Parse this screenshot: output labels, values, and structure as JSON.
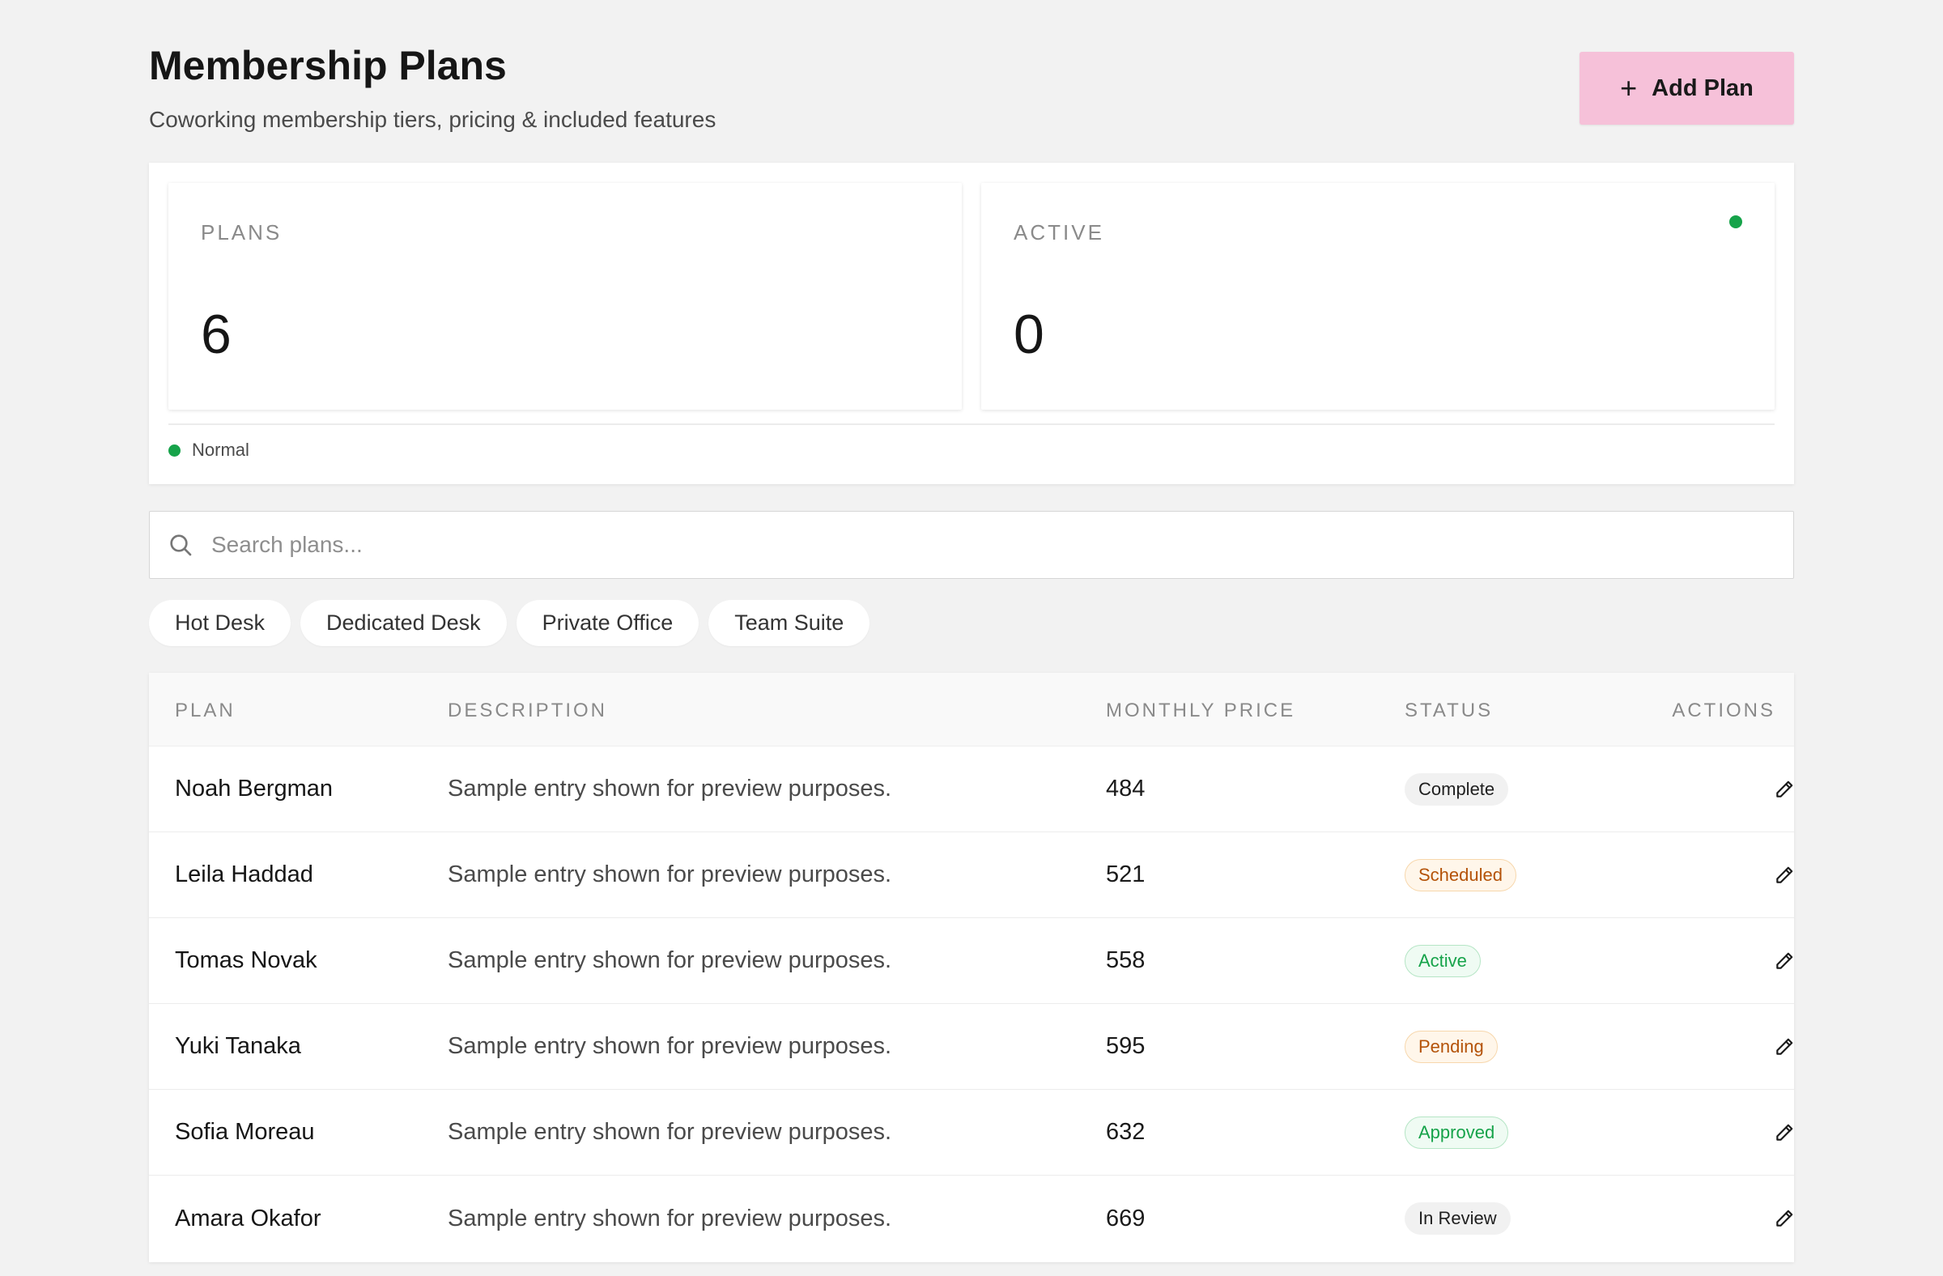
{
  "header": {
    "title": "Membership Plans",
    "subtitle": "Coworking membership tiers, pricing & included features",
    "add_button_label": "Add Plan",
    "add_button_icon": "plus-icon"
  },
  "stats": {
    "cards": [
      {
        "label": "PLANS",
        "value": "6"
      },
      {
        "label": "ACTIVE",
        "value": "0",
        "indicator_color": "#16a34a"
      }
    ],
    "status_text": "Normal",
    "status_color": "#16a34a"
  },
  "search": {
    "placeholder": "Search plans...",
    "value": "",
    "icon": "search-icon"
  },
  "filters": [
    "Hot Desk",
    "Dedicated Desk",
    "Private Office",
    "Team Suite"
  ],
  "table": {
    "columns": [
      "PLAN",
      "DESCRIPTION",
      "MONTHLY PRICE",
      "STATUS",
      "ACTIONS"
    ],
    "rows": [
      {
        "plan": "Noah Bergman",
        "description": "Sample entry shown for preview purposes.",
        "price": "484",
        "status": "Complete",
        "status_tone": "neutral"
      },
      {
        "plan": "Leila Haddad",
        "description": "Sample entry shown for preview purposes.",
        "price": "521",
        "status": "Scheduled",
        "status_tone": "amber"
      },
      {
        "plan": "Tomas Novak",
        "description": "Sample entry shown for preview purposes.",
        "price": "558",
        "status": "Active",
        "status_tone": "green"
      },
      {
        "plan": "Yuki Tanaka",
        "description": "Sample entry shown for preview purposes.",
        "price": "595",
        "status": "Pending",
        "status_tone": "amber"
      },
      {
        "plan": "Sofia Moreau",
        "description": "Sample entry shown for preview purposes.",
        "price": "632",
        "status": "Approved",
        "status_tone": "green"
      },
      {
        "plan": "Amara Okafor",
        "description": "Sample entry shown for preview purposes.",
        "price": "669",
        "status": "In Review",
        "status_tone": "neutral"
      }
    ],
    "action_icon": "pencil-icon"
  },
  "colors": {
    "accent_button": "#f6c1d9",
    "success": "#16a34a",
    "warning": "#b45309",
    "background": "#f2f2f2"
  }
}
